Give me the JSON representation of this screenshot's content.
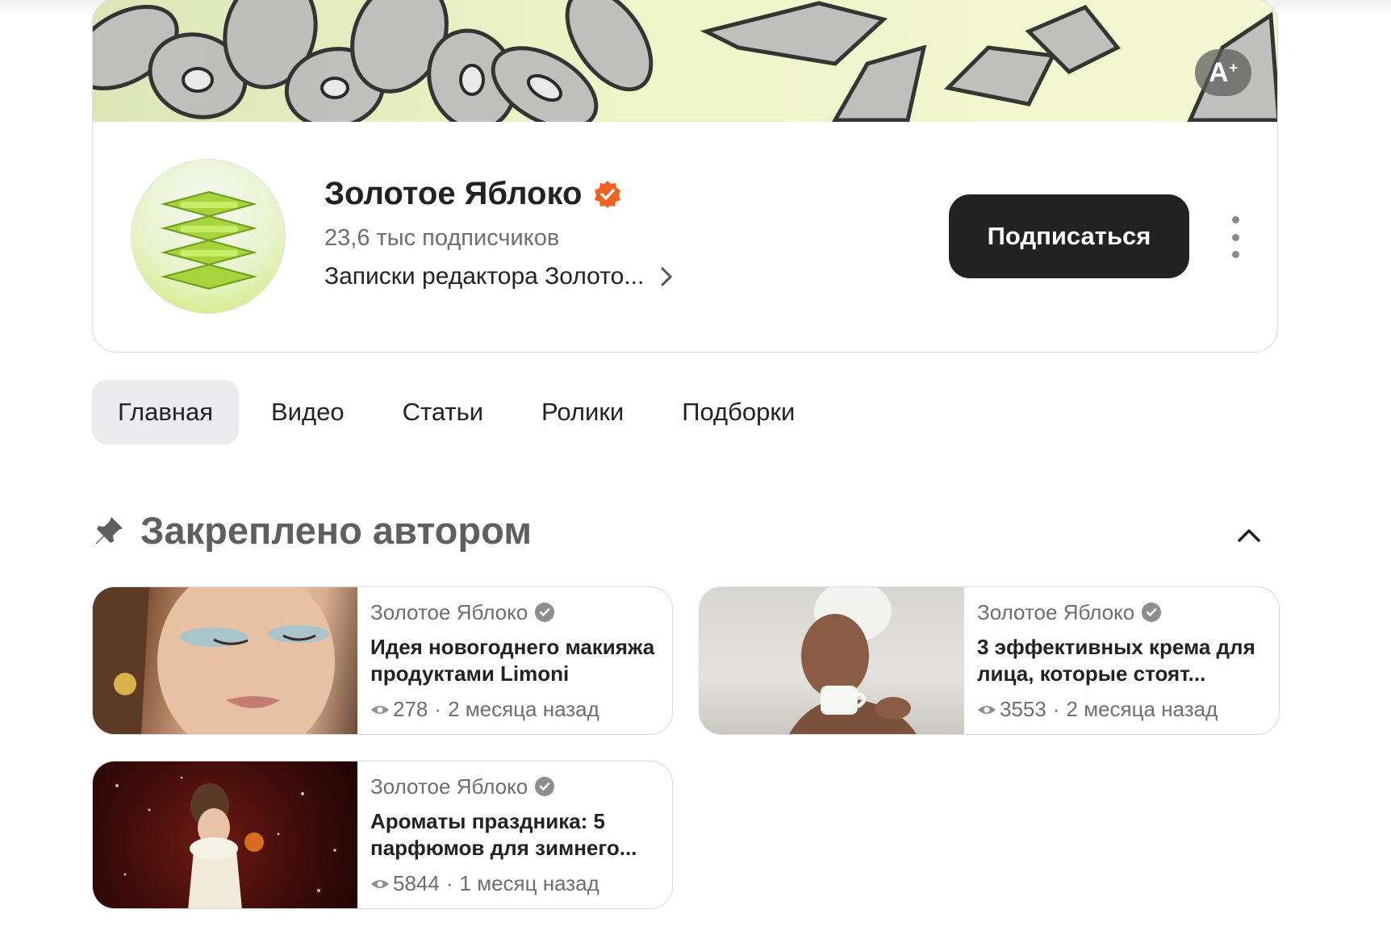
{
  "channel": {
    "name": "Золотое Яблоко",
    "subscribers": "23,6 тыс подписчиков",
    "description": "Записки редактора Золото...",
    "accent": "#f45f22",
    "banner_colors": [
      "#dde6b8",
      "#f4f8d2"
    ]
  },
  "font_size_button": {
    "label": "A",
    "sup": "+"
  },
  "subscribe_label": "Подписаться",
  "tabs": [
    {
      "label": "Главная",
      "active": true
    },
    {
      "label": "Видео"
    },
    {
      "label": "Статьи"
    },
    {
      "label": "Ролики"
    },
    {
      "label": "Подборки"
    }
  ],
  "pinned": {
    "title": "Закреплено автором",
    "items": [
      {
        "author": "Золотое Яблоко",
        "title": "Идея новогоднего макияжа продуктами Limoni",
        "views": "278",
        "sep": "·",
        "age": "2 месяца назад"
      },
      {
        "author": "Золотое Яблоко",
        "title": "3 эффективных крема для лица, которые стоят...",
        "views": "3553",
        "sep": "·",
        "age": "2 месяца назад"
      },
      {
        "author": "Золотое Яблоко",
        "title": "Ароматы праздника: 5 парфюмов для зимнего...",
        "views": "5844",
        "sep": "·",
        "age": "1 месяц назад"
      }
    ]
  },
  "icons": {
    "verified": "verified-check-icon",
    "chevron": "chevron-right-icon",
    "more": "more-vertical-icon",
    "pin": "pin-icon",
    "collapse": "chevron-up-icon",
    "views": "eye-icon"
  }
}
